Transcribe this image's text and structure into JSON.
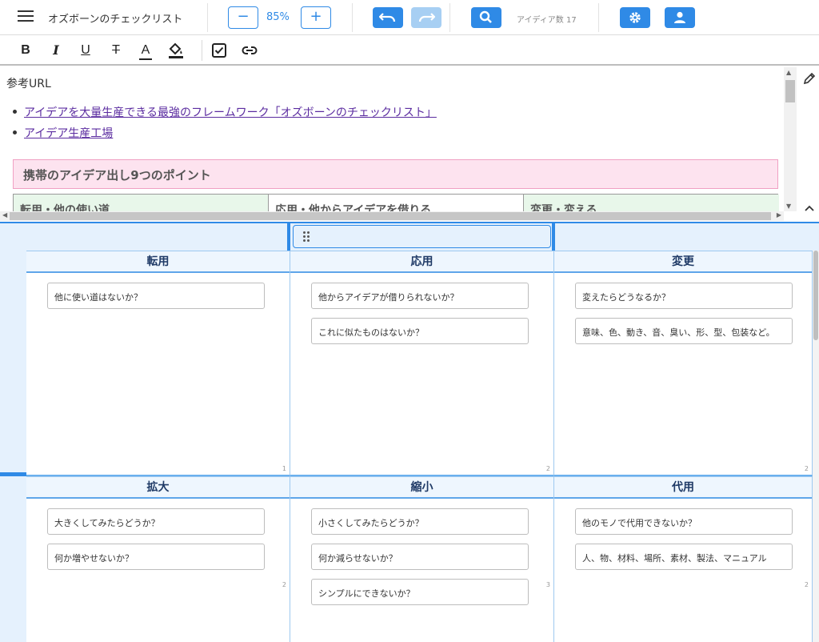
{
  "toolbar": {
    "doc_title": "オズボーンのチェックリスト",
    "zoom_out": "−",
    "zoom_level": "85%",
    "zoom_in": "+",
    "idea_count": "アイディア数 17",
    "icons": [
      "menu-icon",
      "undo-icon",
      "redo-icon",
      "search-icon",
      "gear-icon",
      "user-icon"
    ],
    "accent_color": "#2f8ae6"
  },
  "format_bar": {
    "bold": "B",
    "italic": "I",
    "underline": "U",
    "strikethrough": "T",
    "font_color": "A",
    "icons": [
      "fill-color-icon",
      "checkbox-icon",
      "link-icon"
    ]
  },
  "notes": {
    "title": "参考URL",
    "links": [
      "アイデアを大量生産できる最強のフレームワーク「オズボーンのチェックリスト」",
      "アイデア生産工場"
    ],
    "section_heading": "携帯のアイデア出し9つのポイント",
    "table_peek": [
      "転用・他の使い道",
      "応用・他からアイデアを借りる",
      "変更・変える"
    ]
  },
  "board": {
    "cells": [
      {
        "title": "転用",
        "cards": [
          "他に使い道はないか？"
        ],
        "count": "1"
      },
      {
        "title": "応用",
        "cards": [
          "他からアイデアが借りられないか？",
          "これに似たものはないか？"
        ],
        "count": "2"
      },
      {
        "title": "変更",
        "cards": [
          "変えたらどうなるか？",
          "意味、色、動き、音、臭い、形、型、包装など。"
        ],
        "count": "2"
      },
      {
        "title": "拡大",
        "cards": [
          "大きくしてみたらどうか？",
          "何か増やせないか？"
        ],
        "count": "2"
      },
      {
        "title": "縮小",
        "cards": [
          "小さくしてみたらどうか？",
          "何か減らせないか？",
          "シンプルにできないか？"
        ],
        "count": "3"
      },
      {
        "title": "代用",
        "cards": [
          "他のモノで代用できないか？",
          "人、物、材料、場所、素材、製法、マニュアル"
        ],
        "count": "2"
      }
    ]
  }
}
